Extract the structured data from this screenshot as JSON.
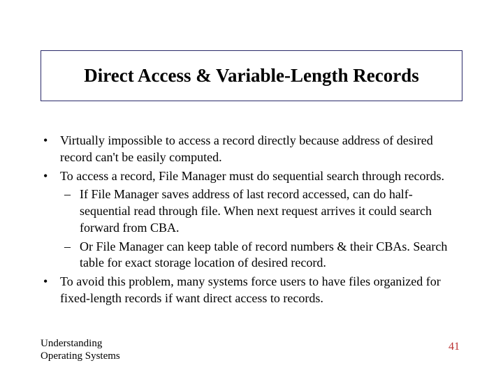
{
  "title": "Direct Access & Variable-Length Records",
  "bullets": {
    "b1": "Virtually impossible to access a record directly because address of desired record can't be easily computed.",
    "b2": "To access a record, File Manager must do sequential search through records.",
    "b2_sub1": "If File Manager saves address of last record accessed, can do half-sequential read through file. When next request arrives it could search forward from CBA.",
    "b2_sub2": "Or File Manager can keep table of record numbers & their CBAs. Search table for exact storage location of desired record.",
    "b3": "To avoid this problem, many systems force users to have files organized for fixed-length records if want direct access to records."
  },
  "footer": {
    "left_line1": "Understanding",
    "left_line2": "Operating Systems",
    "page_number": "41"
  }
}
